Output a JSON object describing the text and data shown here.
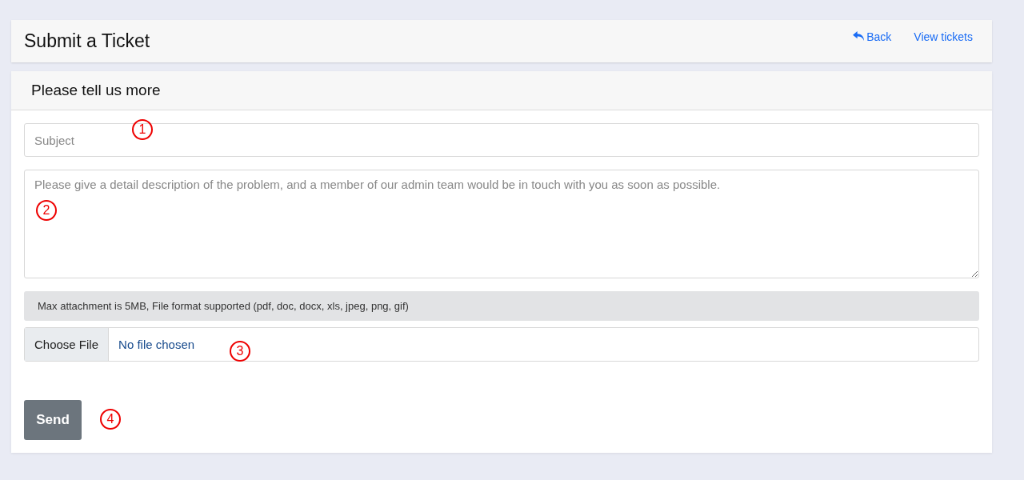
{
  "header": {
    "title": "Submit a Ticket",
    "links": [
      {
        "label": "Back",
        "kind": "back"
      },
      {
        "label": "View tickets",
        "kind": "plain"
      }
    ]
  },
  "form": {
    "heading": "Please tell us more",
    "subject": {
      "placeholder": "Subject",
      "callout": "1"
    },
    "description": {
      "placeholder": "Please give a detail description of the problem, and a member of our admin team would be in touch with you as soon as possible.",
      "callout": "2"
    },
    "attachment_note": "Max attachment is 5MB, File format supported (pdf, doc, docx, xls, jpeg, png, gif)",
    "file": {
      "button": "Choose File",
      "status": "No file chosen",
      "callout": "3"
    },
    "submit": {
      "label": "Send",
      "callout": "4"
    }
  }
}
